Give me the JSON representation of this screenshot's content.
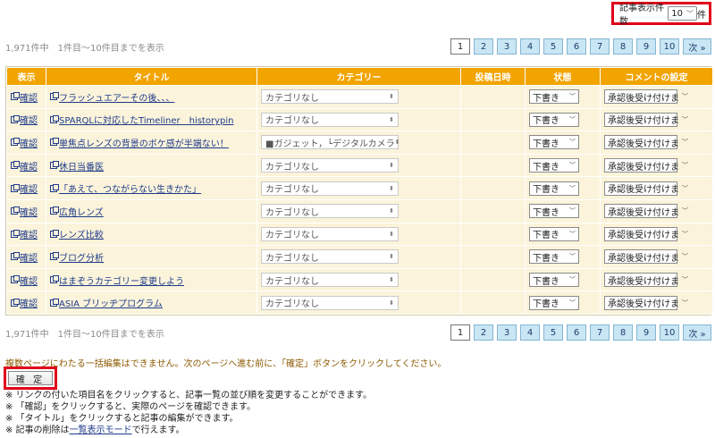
{
  "top": {
    "label": "記事表示件数",
    "select_value": "10",
    "suffix": "件"
  },
  "count_info": "1,971件中　1件目〜10件目までを表示",
  "pager": {
    "pages": [
      "1",
      "2",
      "3",
      "4",
      "5",
      "6",
      "7",
      "8",
      "9",
      "10"
    ],
    "current": "1",
    "next": "次 »"
  },
  "table": {
    "headers": {
      "display": "表示",
      "title": "タイトル",
      "category": "カテゴリー",
      "posted": "投稿日時",
      "status": "状態",
      "comment": "コメントの設定"
    },
    "edit_label": "確認",
    "rows": [
      {
        "title": "フラッシュエアーその後、、、",
        "category": "カテゴリなし",
        "status": "下書き",
        "comment": "承認後受け付けま"
      },
      {
        "title": "SPARQLに対応したTimeliner　historypin",
        "category": "カテゴリなし",
        "status": "下書き",
        "comment": "承認後受け付けま"
      },
      {
        "title": "単焦点レンズの背景のボケ感が半端ない！",
        "category": "■ガジェット，└デジタルカメラ",
        "status": "下書き",
        "comment": "承認後受け付けま"
      },
      {
        "title": "休日当番医",
        "category": "カテゴリなし",
        "status": "下書き",
        "comment": "承認後受け付けま"
      },
      {
        "title": "「あえて、つながらない生きかた」",
        "category": "カテゴリなし",
        "status": "下書き",
        "comment": "承認後受け付けま"
      },
      {
        "title": "広角レンズ",
        "category": "カテゴリなし",
        "status": "下書き",
        "comment": "承認後受け付けま"
      },
      {
        "title": "レンズ比較",
        "category": "カテゴリなし",
        "status": "下書き",
        "comment": "承認後受け付けま"
      },
      {
        "title": "ブログ分析",
        "category": "カテゴリなし",
        "status": "下書き",
        "comment": "承認後受け付けま"
      },
      {
        "title": "はまぞうカテゴリー変更しよう",
        "category": "カテゴリなし",
        "status": "下書き",
        "comment": "承認後受け付けま"
      },
      {
        "title": "ASIA ブリッヂプログラム",
        "category": "カテゴリなし",
        "status": "下書き",
        "comment": "承認後受け付けま"
      }
    ]
  },
  "warning": "複数ページにわたる一括編集はできません。次のページへ進む前に、「確定」ボタンをクリックしてください。",
  "confirm_label": "確 定",
  "notes": [
    "※ リンクの付いた項目名をクリックすると、記事一覧の並び順を変更することができます。",
    "※ 「確認」をクリックすると、実際のページを確認できます。",
    "※ 「タイトル」をクリックすると記事の編集ができます。"
  ],
  "last_note": {
    "prefix": "※ 記事の削除は",
    "link": "一覧表示モード",
    "suffix": "で行えます。"
  },
  "colors": {
    "header_bg": "#f2a400",
    "row_bg": "#fbf4db",
    "highlight": "#e0001b",
    "pager_bg": "#c9e6f5"
  }
}
